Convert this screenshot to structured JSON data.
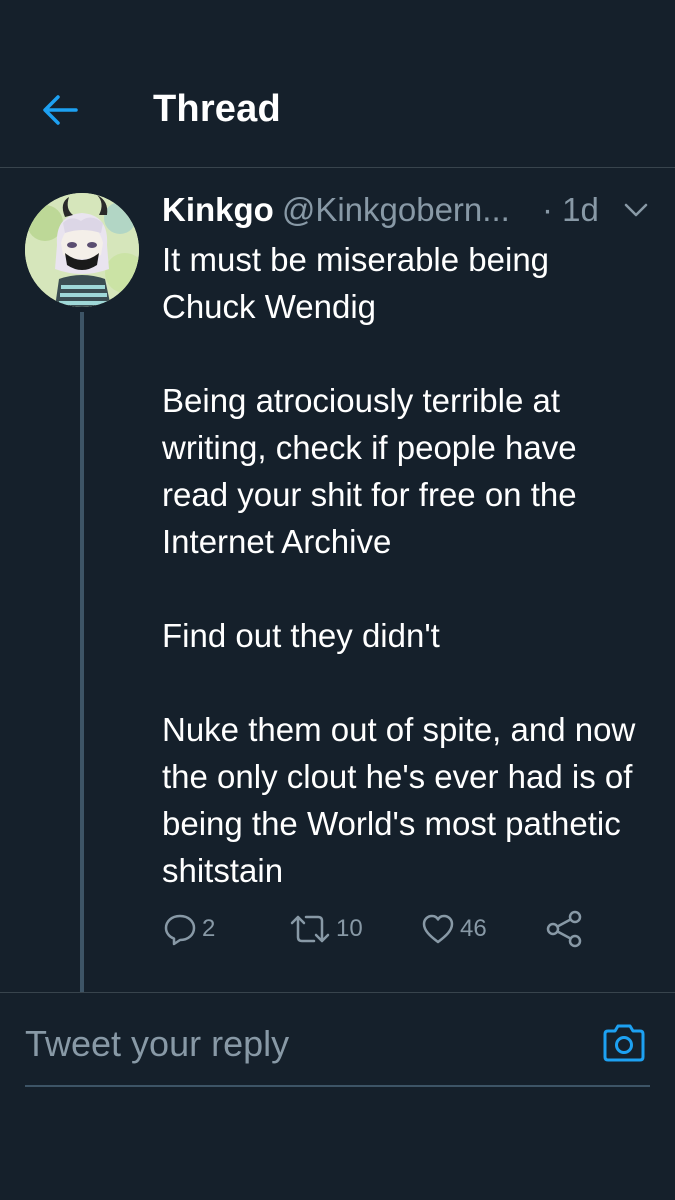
{
  "header": {
    "title": "Thread"
  },
  "tweet": {
    "display_name": "Kinkgo",
    "handle": "@Kinkgobern...",
    "time": "· 1d",
    "paragraphs": [
      "It must be miserable being Chuck Wendig",
      "Being atrociously terrible at writing, check if people have read your shit for free on the Internet Archive",
      "Find out they didn't",
      "Nuke them out of spite, and now the only clout he's ever had is of being the World's most pathetic shitstain"
    ],
    "reply_count": "2",
    "retweet_count": "10",
    "like_count": "46"
  },
  "reply": {
    "placeholder": "Tweet your reply"
  },
  "colors": {
    "background": "#15202b",
    "accent": "#1da1f2",
    "secondary_text": "#8899a6",
    "divider": "#38444d"
  },
  "icons": {
    "back": "arrow-left-icon",
    "more": "chevron-down-icon",
    "reply": "comment-icon",
    "retweet": "retweet-icon",
    "like": "heart-icon",
    "share": "share-icon",
    "camera": "camera-icon"
  }
}
